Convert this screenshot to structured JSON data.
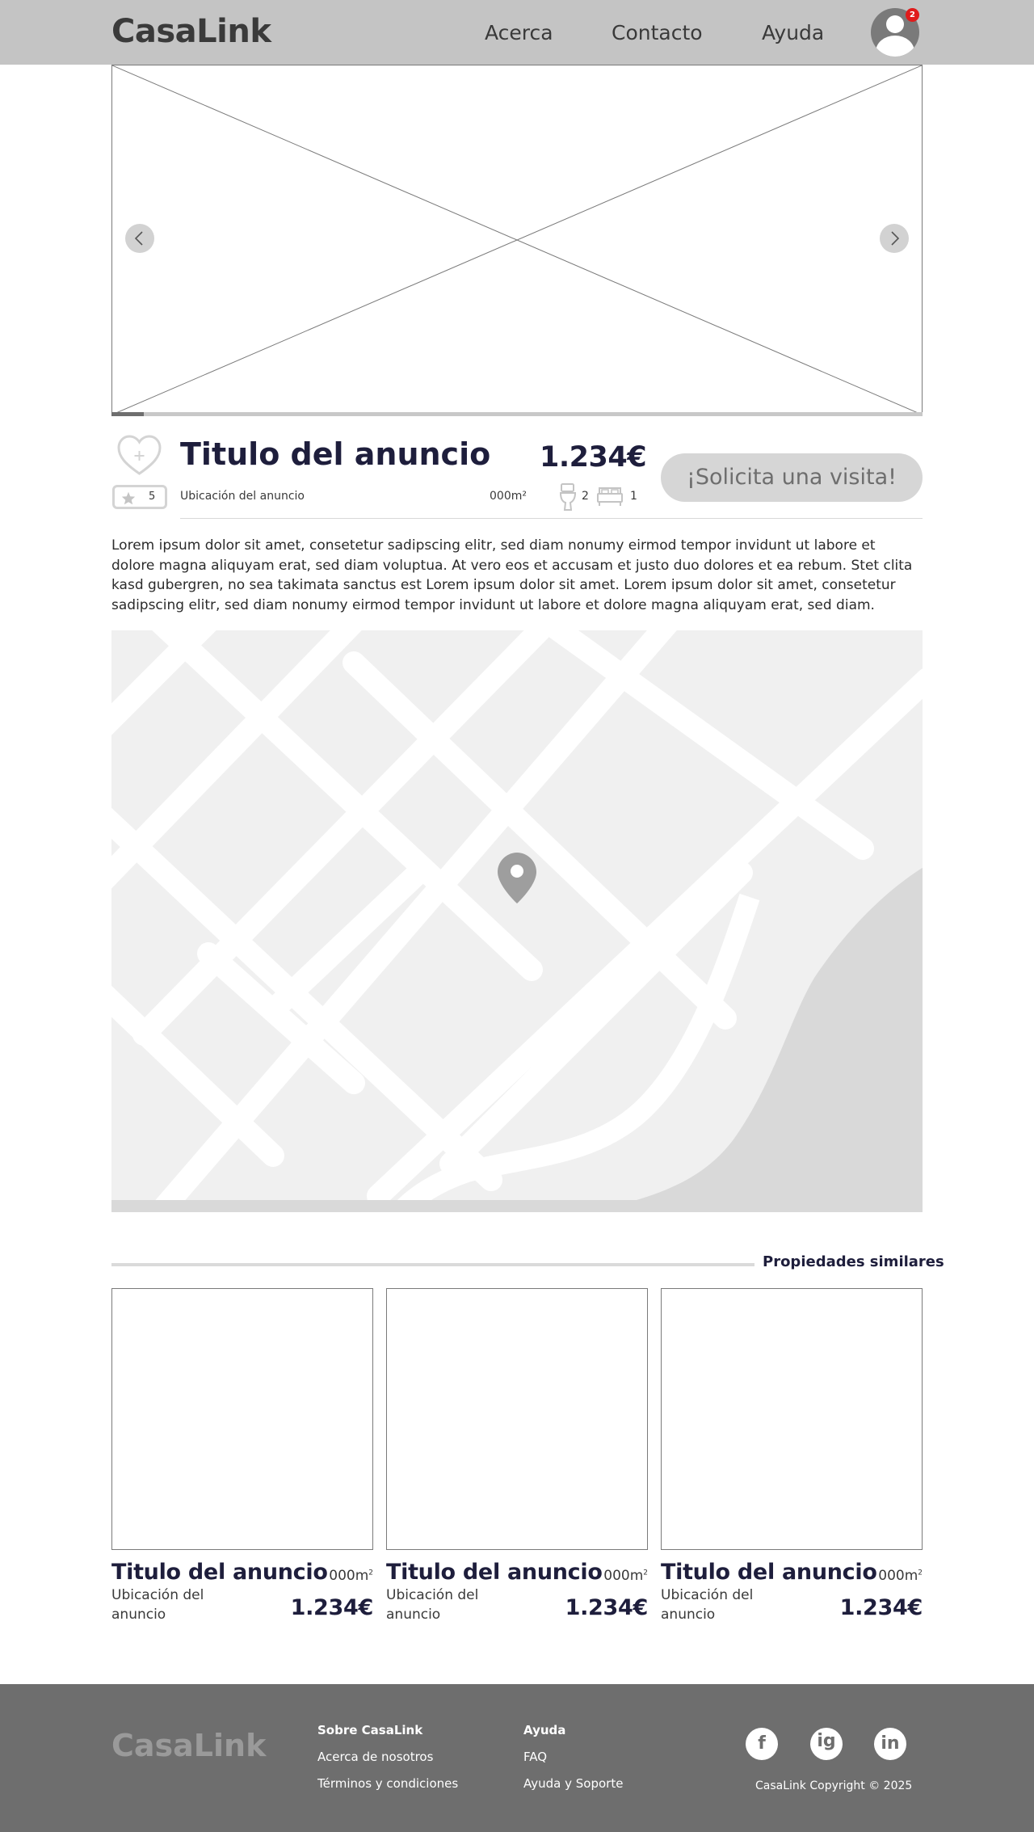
{
  "header": {
    "logo": "CasaLink",
    "nav": [
      "Acerca",
      "Contacto",
      "Ayuda"
    ],
    "notification_count": "2"
  },
  "carousel": {
    "progress": 0.04
  },
  "listing": {
    "title": "Titulo del anuncio",
    "location": "Ubicación del anuncio",
    "rating": "5",
    "price": "1.234€",
    "area": "000m²",
    "bathrooms": "2",
    "bedrooms": "1",
    "cta_label": "¡Solicita una visita!",
    "description": "Lorem ipsum dolor sit amet, consetetur sadipscing elitr, sed diam nonumy eirmod tempor invidunt ut labore et dolore magna aliquyam erat, sed diam voluptua. At vero eos et accusam et justo duo dolores et ea rebum. Stet clita kasd gubergren, no sea takimata sanctus est Lorem ipsum dolor sit amet. Lorem ipsum dolor sit amet, consetetur sadipscing elitr, sed diam nonumy eirmod tempor invidunt ut labore et dolore magna aliquyam erat, sed diam."
  },
  "similar": {
    "heading": "Propiedades similares",
    "cards": [
      {
        "title": "Titulo del anuncio",
        "area": "000m",
        "area_sup": "2",
        "location": "Ubicación del anuncio",
        "price": "1.234€"
      },
      {
        "title": "Titulo del anuncio",
        "area": "000m",
        "area_sup": "2",
        "location": "Ubicación del anuncio",
        "price": "1.234€"
      },
      {
        "title": "Titulo del anuncio",
        "area": "000m",
        "area_sup": "2",
        "location": "Ubicación del anuncio",
        "price": "1.234€"
      }
    ]
  },
  "footer": {
    "logo": "CasaLink",
    "col1": {
      "heading": "Sobre CasaLink",
      "links": [
        "Acerca de nosotros",
        "Términos y condiciones"
      ]
    },
    "col2": {
      "heading": "Ayuda",
      "links": [
        "FAQ",
        "Ayuda y Soporte"
      ]
    },
    "social": {
      "facebook": "f",
      "instagram": "ig",
      "linkedin": "in"
    },
    "copyright": "CasaLink Copyright © 2025"
  },
  "colors": {
    "header_bg": "#c4c4c4",
    "footer_bg": "#6e6e6e",
    "title_navy": "#1e1e3c",
    "cta_bg": "#d6d6d6",
    "notification_badge": "#e01b1b",
    "map_bg": "#f0f0f0",
    "map_pin": "#9e9e9e"
  },
  "icons": [
    "user-avatar-icon",
    "chevron-left-icon",
    "chevron-right-icon",
    "heart-plus-icon",
    "star-icon",
    "toilet-icon",
    "bed-icon",
    "map-pin-icon",
    "facebook-icon",
    "instagram-icon",
    "linkedin-icon"
  ]
}
